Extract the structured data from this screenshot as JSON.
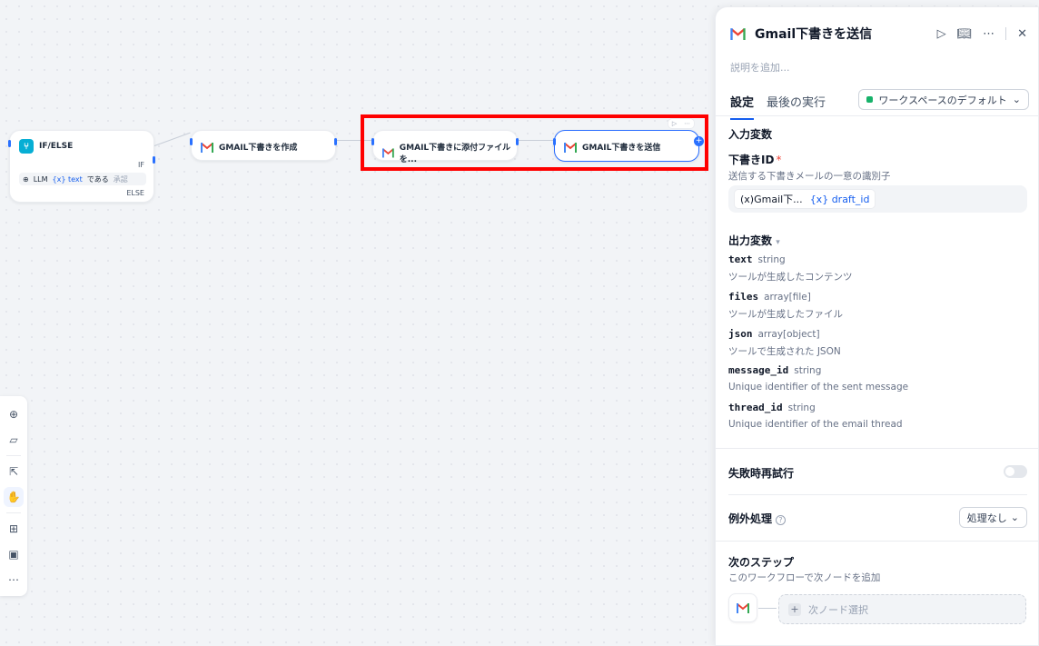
{
  "canvas": {
    "ifelse": {
      "title": "IF/ELSE",
      "if_label": "IF",
      "cond_llm": "LLM",
      "cond_var": "{x} text",
      "cond_op": "である",
      "cond_value": "承認",
      "else_label": "ELSE"
    },
    "nodes": [
      {
        "label": "GMAIL下書きを作成"
      },
      {
        "label": "GMAIL下書きに添付ファイルを..."
      },
      {
        "label": "GMAIL下書きを送信"
      }
    ]
  },
  "panel": {
    "title": "Gmail下書きを送信",
    "description_placeholder": "説明を追加...",
    "tabs": [
      "設定",
      "最後の実行"
    ],
    "workspace_button": "ワークスペースのデフォルト",
    "input_section": "入力変数",
    "draft_id_label": "下書きID",
    "draft_id_required": "*",
    "draft_id_desc": "送信する下書きメールの一意の識別子",
    "draft_id_var_source": "Gmail下...",
    "draft_id_var_name": "{x} draft_id",
    "output_section": "出力変数",
    "outputs": [
      {
        "name": "text",
        "type": "string",
        "desc": "ツールが生成したコンテンツ"
      },
      {
        "name": "files",
        "type": "array[file]",
        "desc": "ツールが生成したファイル"
      },
      {
        "name": "json",
        "type": "array[object]",
        "desc": "ツールで生成された JSON"
      },
      {
        "name": "message_id",
        "type": "string",
        "desc": "Unique identifier of the sent message"
      },
      {
        "name": "thread_id",
        "type": "string",
        "desc": "Unique identifier of the email thread"
      }
    ],
    "retry_label": "失敗時再試行",
    "exception_label": "例外処理",
    "exception_value": "処理なし",
    "next_step_title": "次のステップ",
    "next_step_desc": "このワークフローで次ノードを追加",
    "next_select_placeholder": "次ノード選択"
  }
}
